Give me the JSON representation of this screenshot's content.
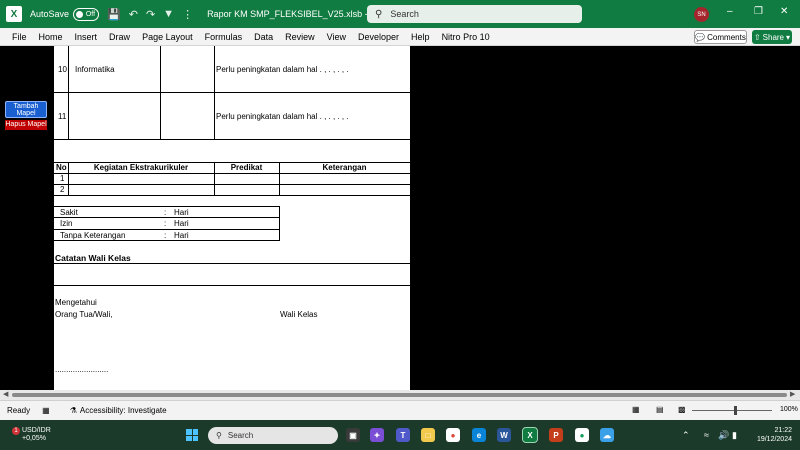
{
  "titlebar": {
    "app_icon": "excel-icon",
    "autosave_label": "AutoSave",
    "autosave_state": "Off",
    "doc_title": "Rapor KM SMP_FLEKSIBEL_V25.xlsb - E...",
    "search_placeholder": "Search",
    "user_initials": "SN"
  },
  "ribbon_tabs": [
    "File",
    "Home",
    "Insert",
    "Draw",
    "Page Layout",
    "Formulas",
    "Data",
    "Review",
    "View",
    "Developer",
    "Help",
    "Nitro Pro 10"
  ],
  "comments_label": "Comments",
  "share_label": "Share",
  "macro_buttons": {
    "tambah": "Tambah Mapel",
    "hapus": "Hapus Mapel"
  },
  "sheet": {
    "subjects": [
      {
        "no": "10",
        "name": "Informatika",
        "note": "Perlu peningkatan dalam hal . , . , . , ."
      },
      {
        "no": "11",
        "name": "",
        "note": "Perlu peningkatan dalam hal . , . , . , ."
      }
    ],
    "extracurricular": {
      "headers": [
        "No",
        "Kegiatan Ekstrakurikuler",
        "Predikat",
        "Keterangan"
      ],
      "rows": [
        "1",
        "2"
      ]
    },
    "attendance": [
      {
        "label": "Sakit",
        "sep": ":",
        "unit": "Hari"
      },
      {
        "label": "Izin",
        "sep": ":",
        "unit": "Hari"
      },
      {
        "label": "Tanpa Keterangan",
        "sep": ":",
        "unit": "Hari"
      }
    ],
    "catatan_title": "Catatan Wali Kelas",
    "mengetahui": "Mengetahui",
    "orang_tua": "Orang Tua/Wali,",
    "wali_kelas": "Wali Kelas",
    "signature_dots": "........................"
  },
  "statusbar": {
    "ready": "Ready",
    "accessibility": "Accessibility: Investigate",
    "zoom": "100%"
  },
  "taskbar": {
    "fx_pair": "USD/IDR",
    "fx_change": "+0,05%",
    "notif_count": "1",
    "search_label": "Search",
    "time": "21:22",
    "date": "19/12/2024"
  }
}
